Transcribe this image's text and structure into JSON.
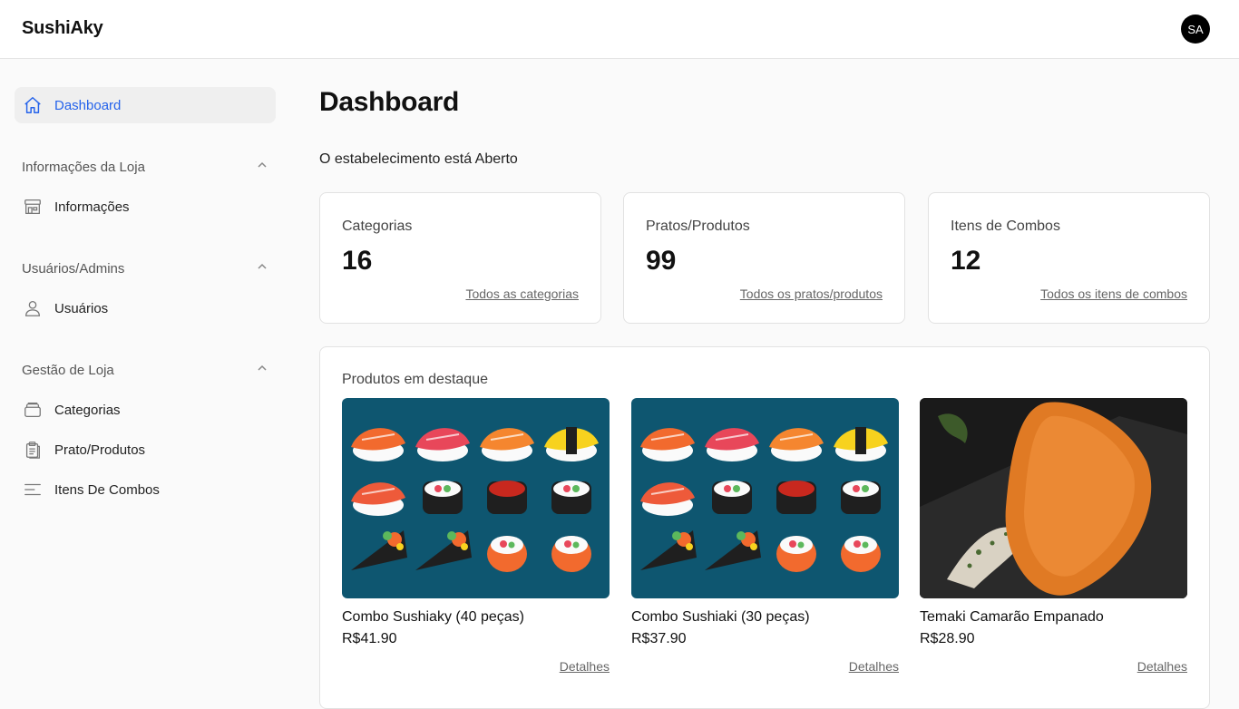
{
  "app": {
    "brand": "SushiAky",
    "avatar_initials": "SA"
  },
  "sidebar": {
    "dashboard": {
      "label": "Dashboard",
      "icon": "home-icon"
    },
    "sections": [
      {
        "title": "Informações da Loja",
        "items": [
          {
            "label": "Informações",
            "icon": "store-icon"
          }
        ]
      },
      {
        "title": "Usuários/Admins",
        "items": [
          {
            "label": "Usuários",
            "icon": "user-icon"
          }
        ]
      },
      {
        "title": "Gestão de Loja",
        "items": [
          {
            "label": "Categorias",
            "icon": "stack-icon"
          },
          {
            "label": "Prato/Produtos",
            "icon": "clipboard-icon"
          },
          {
            "label": "Itens De Combos",
            "icon": "list-icon"
          }
        ]
      }
    ]
  },
  "main": {
    "title": "Dashboard",
    "status_text": "O estabelecimento está Aberto",
    "stats": [
      {
        "label": "Categorias",
        "value": "16",
        "link": "Todos as categorias"
      },
      {
        "label": "Pratos/Produtos",
        "value": "99",
        "link": "Todos os pratos/produtos"
      },
      {
        "label": "Itens de Combos",
        "value": "12",
        "link": "Todos os itens de combos"
      }
    ],
    "featured": {
      "title": "Produtos em destaque",
      "products": [
        {
          "name": "Combo Sushiaky (40 peças)",
          "price": "R$41.90",
          "details": "Detalhes"
        },
        {
          "name": "Combo Sushiaki (30 peças)",
          "price": "R$37.90",
          "details": "Detalhes"
        },
        {
          "name": "Temaki Camarão Empanado",
          "price": "R$28.90",
          "details": "Detalhes"
        }
      ]
    }
  },
  "colors": {
    "accent": "#2563eb",
    "sushi_bg": "#0e5670",
    "salmon": "#f26a2e",
    "fried": "#e07a24"
  }
}
